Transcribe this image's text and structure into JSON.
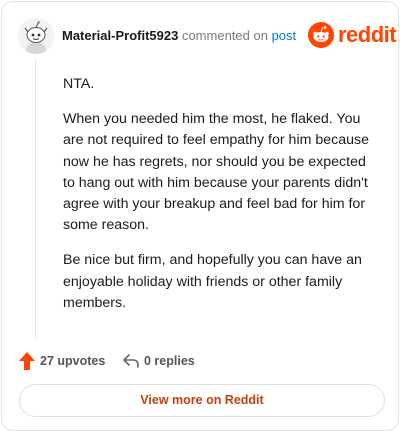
{
  "comment": {
    "username": "Material-Profit5923",
    "commented_text": "commented on",
    "post_link": "post",
    "paragraphs": [
      "NTA.",
      "When you needed him the most, he flaked. You are not required to feel empathy for him because now he has regrets, nor should you be expected to hang out with him because your parents didn't agree with your breakup and feel bad for him for some reason.",
      "Be nice but firm, and hopefully you can have an enjoyable holiday with friends or other family members."
    ],
    "upvotes": "27 upvotes",
    "replies": "0 replies"
  },
  "brand": {
    "name": "reddit",
    "icon": "reddit-logo-icon",
    "color": "#ff4500"
  },
  "icons": {
    "upvote": "upvote-arrow-icon",
    "reply": "reply-arrow-icon",
    "avatar": "snoo-avatar"
  },
  "cta": {
    "label": "View more on Reddit"
  }
}
